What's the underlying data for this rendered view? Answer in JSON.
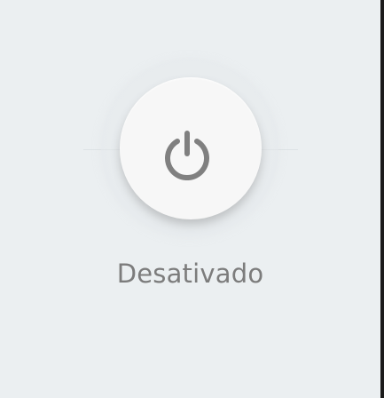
{
  "power_toggle": {
    "state": "off",
    "status_label": "Desativado",
    "icon": "power-icon"
  },
  "colors": {
    "background": "#ebeff1",
    "button": "#f7f7f7",
    "icon": "#808080",
    "label": "#7c7c7c"
  }
}
